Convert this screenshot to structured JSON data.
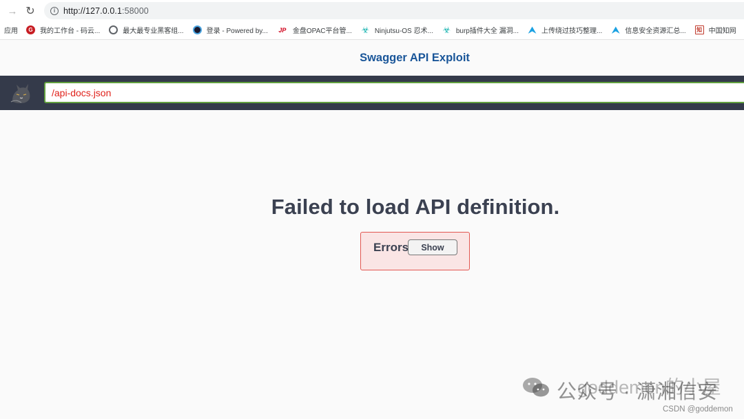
{
  "browser": {
    "url_host": "http://127.0.0.1",
    "url_port": ":58000",
    "bookmarks": [
      {
        "label": "应用",
        "icon": "apps"
      },
      {
        "label": "我的工作台 - 码云...",
        "icon": "gitee-icon"
      },
      {
        "label": "最大最专业黑客组...",
        "icon": "globe-icon"
      },
      {
        "label": "登录 - Powered by...",
        "icon": "dark-circle-icon"
      },
      {
        "label": "金盘OPAC平台管...",
        "icon": "jp-icon"
      },
      {
        "label": "Ninjutsu-OS 忍术...",
        "icon": "biohazard-icon"
      },
      {
        "label": "burp插件大全 漏洞...",
        "icon": "biohazard-icon"
      },
      {
        "label": "上传绕过技巧整理...",
        "icon": "arrow-icon"
      },
      {
        "label": "信息安全资源汇总...",
        "icon": "arrow-icon"
      },
      {
        "label": "中国知网",
        "icon": "cnki-icon"
      }
    ]
  },
  "swagger": {
    "title": "Swagger API Exploit",
    "api_url": "/api-docs.json",
    "error_title": "Failed to load API definition.",
    "errors_label": "Errors",
    "show_label": "Show"
  },
  "watermark": {
    "text": "公众号 · 潇湘信安",
    "overlay": "goddemon的小屋",
    "csdn": "CSDN @goddemon"
  },
  "colors": {
    "topbar": "#343a4a",
    "title": "#1a5699",
    "input_border": "#62a03f",
    "input_text": "#e0211a",
    "error_bg": "#fae5e5",
    "error_border": "#e25650"
  }
}
